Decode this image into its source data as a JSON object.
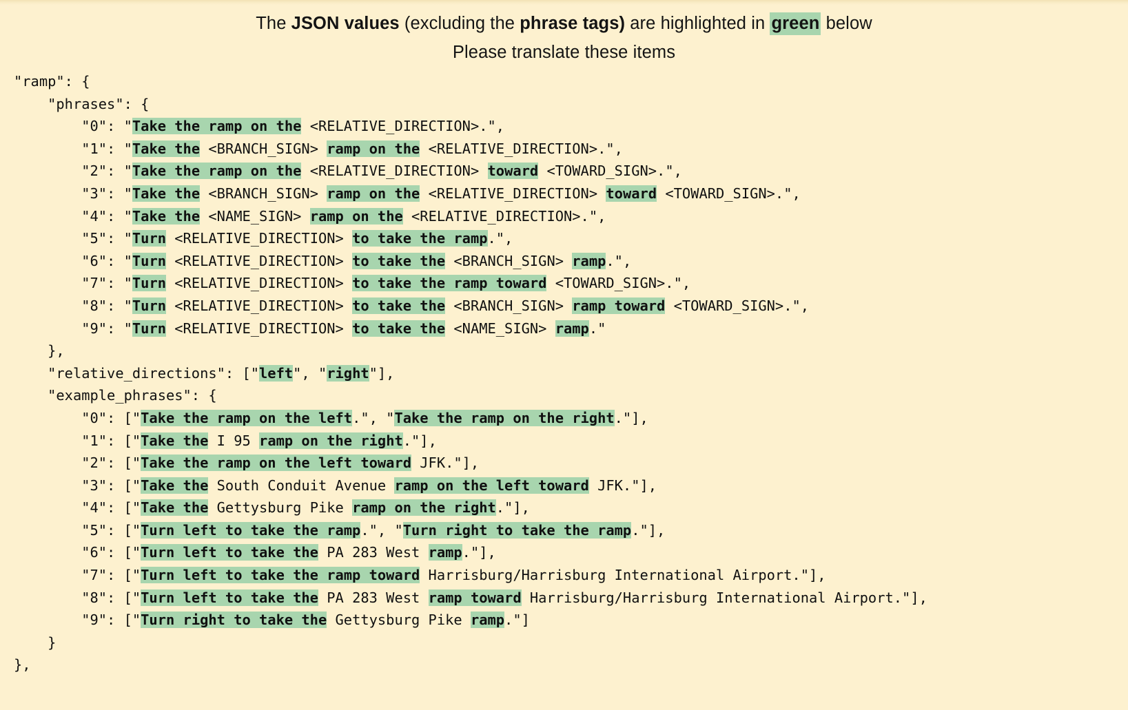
{
  "instructions": {
    "line1_a": "The ",
    "line1_b": "JSON values",
    "line1_c": " (excluding the ",
    "line1_d": "phrase tags)",
    "line1_e": " are highlighted in ",
    "line1_f": "green",
    "line1_g": " below",
    "line2": "Please translate these items"
  },
  "colors": {
    "page_background": "#fdf1cf",
    "highlight_green": "#a8d5ae",
    "text": "#141414"
  },
  "code_lines": [
    {
      "indent": 0,
      "segments": [
        {
          "t": "\"ramp\": {",
          "hl": false
        }
      ]
    },
    {
      "indent": 1,
      "segments": [
        {
          "t": "\"phrases\": {",
          "hl": false
        }
      ]
    },
    {
      "indent": 2,
      "segments": [
        {
          "t": "\"0\": \"",
          "hl": false
        },
        {
          "t": "Take the ramp on the",
          "hl": true
        },
        {
          "t": " <RELATIVE_DIRECTION>.\",",
          "hl": false
        }
      ]
    },
    {
      "indent": 2,
      "segments": [
        {
          "t": "\"1\": \"",
          "hl": false
        },
        {
          "t": "Take the",
          "hl": true
        },
        {
          "t": " <BRANCH_SIGN> ",
          "hl": false
        },
        {
          "t": "ramp on the",
          "hl": true
        },
        {
          "t": " <RELATIVE_DIRECTION>.\",",
          "hl": false
        }
      ]
    },
    {
      "indent": 2,
      "segments": [
        {
          "t": "\"2\": \"",
          "hl": false
        },
        {
          "t": "Take the ramp on the",
          "hl": true
        },
        {
          "t": " <RELATIVE_DIRECTION> ",
          "hl": false
        },
        {
          "t": "toward",
          "hl": true
        },
        {
          "t": " <TOWARD_SIGN>.\",",
          "hl": false
        }
      ]
    },
    {
      "indent": 2,
      "segments": [
        {
          "t": "\"3\": \"",
          "hl": false
        },
        {
          "t": "Take the",
          "hl": true
        },
        {
          "t": " <BRANCH_SIGN> ",
          "hl": false
        },
        {
          "t": "ramp on the",
          "hl": true
        },
        {
          "t": " <RELATIVE_DIRECTION> ",
          "hl": false
        },
        {
          "t": "toward",
          "hl": true
        },
        {
          "t": " <TOWARD_SIGN>.\",",
          "hl": false
        }
      ]
    },
    {
      "indent": 2,
      "segments": [
        {
          "t": "\"4\": \"",
          "hl": false
        },
        {
          "t": "Take the",
          "hl": true
        },
        {
          "t": " <NAME_SIGN> ",
          "hl": false
        },
        {
          "t": "ramp on the",
          "hl": true
        },
        {
          "t": " <RELATIVE_DIRECTION>.\",",
          "hl": false
        }
      ]
    },
    {
      "indent": 2,
      "segments": [
        {
          "t": "\"5\": \"",
          "hl": false
        },
        {
          "t": "Turn",
          "hl": true
        },
        {
          "t": " <RELATIVE_DIRECTION> ",
          "hl": false
        },
        {
          "t": "to take the ramp",
          "hl": true
        },
        {
          "t": ".\",",
          "hl": false
        }
      ]
    },
    {
      "indent": 2,
      "segments": [
        {
          "t": "\"6\": \"",
          "hl": false
        },
        {
          "t": "Turn",
          "hl": true
        },
        {
          "t": " <RELATIVE_DIRECTION> ",
          "hl": false
        },
        {
          "t": "to take the",
          "hl": true
        },
        {
          "t": " <BRANCH_SIGN> ",
          "hl": false
        },
        {
          "t": "ramp",
          "hl": true
        },
        {
          "t": ".\",",
          "hl": false
        }
      ]
    },
    {
      "indent": 2,
      "segments": [
        {
          "t": "\"7\": \"",
          "hl": false
        },
        {
          "t": "Turn",
          "hl": true
        },
        {
          "t": " <RELATIVE_DIRECTION> ",
          "hl": false
        },
        {
          "t": "to take the ramp toward",
          "hl": true
        },
        {
          "t": " <TOWARD_SIGN>.\",",
          "hl": false
        }
      ]
    },
    {
      "indent": 2,
      "segments": [
        {
          "t": "\"8\": \"",
          "hl": false
        },
        {
          "t": "Turn",
          "hl": true
        },
        {
          "t": " <RELATIVE_DIRECTION> ",
          "hl": false
        },
        {
          "t": "to take the",
          "hl": true
        },
        {
          "t": " <BRANCH_SIGN> ",
          "hl": false
        },
        {
          "t": "ramp toward",
          "hl": true
        },
        {
          "t": " <TOWARD_SIGN>.\",",
          "hl": false
        }
      ]
    },
    {
      "indent": 2,
      "segments": [
        {
          "t": "\"9\": \"",
          "hl": false
        },
        {
          "t": "Turn",
          "hl": true
        },
        {
          "t": " <RELATIVE_DIRECTION> ",
          "hl": false
        },
        {
          "t": "to take the",
          "hl": true
        },
        {
          "t": " <NAME_SIGN> ",
          "hl": false
        },
        {
          "t": "ramp",
          "hl": true
        },
        {
          "t": ".\"",
          "hl": false
        }
      ]
    },
    {
      "indent": 1,
      "segments": [
        {
          "t": "},",
          "hl": false
        }
      ]
    },
    {
      "indent": 1,
      "segments": [
        {
          "t": "\"relative_directions\": [\"",
          "hl": false
        },
        {
          "t": "left",
          "hl": true
        },
        {
          "t": "\", \"",
          "hl": false
        },
        {
          "t": "right",
          "hl": true
        },
        {
          "t": "\"],",
          "hl": false
        }
      ]
    },
    {
      "indent": 1,
      "segments": [
        {
          "t": "\"example_phrases\": {",
          "hl": false
        }
      ]
    },
    {
      "indent": 2,
      "segments": [
        {
          "t": "\"0\": [\"",
          "hl": false
        },
        {
          "t": "Take the ramp on the left",
          "hl": true
        },
        {
          "t": ".\", \"",
          "hl": false
        },
        {
          "t": "Take the ramp on the right",
          "hl": true
        },
        {
          "t": ".\"],",
          "hl": false
        }
      ]
    },
    {
      "indent": 2,
      "segments": [
        {
          "t": "\"1\": [\"",
          "hl": false
        },
        {
          "t": "Take the",
          "hl": true
        },
        {
          "t": " I 95 ",
          "hl": false
        },
        {
          "t": "ramp on the right",
          "hl": true
        },
        {
          "t": ".\"],",
          "hl": false
        }
      ]
    },
    {
      "indent": 2,
      "segments": [
        {
          "t": "\"2\": [\"",
          "hl": false
        },
        {
          "t": "Take the ramp on the left toward",
          "hl": true
        },
        {
          "t": " JFK.\"],",
          "hl": false
        }
      ]
    },
    {
      "indent": 2,
      "segments": [
        {
          "t": "\"3\": [\"",
          "hl": false
        },
        {
          "t": "Take the",
          "hl": true
        },
        {
          "t": " South Conduit Avenue ",
          "hl": false
        },
        {
          "t": "ramp on the left toward",
          "hl": true
        },
        {
          "t": " JFK.\"],",
          "hl": false
        }
      ]
    },
    {
      "indent": 2,
      "segments": [
        {
          "t": "\"4\": [\"",
          "hl": false
        },
        {
          "t": "Take the",
          "hl": true
        },
        {
          "t": " Gettysburg Pike ",
          "hl": false
        },
        {
          "t": "ramp on the right",
          "hl": true
        },
        {
          "t": ".\"],",
          "hl": false
        }
      ]
    },
    {
      "indent": 2,
      "segments": [
        {
          "t": "\"5\": [\"",
          "hl": false
        },
        {
          "t": "Turn left to take the ramp",
          "hl": true
        },
        {
          "t": ".\", \"",
          "hl": false
        },
        {
          "t": "Turn right to take the ramp",
          "hl": true
        },
        {
          "t": ".\"],",
          "hl": false
        }
      ]
    },
    {
      "indent": 2,
      "segments": [
        {
          "t": "\"6\": [\"",
          "hl": false
        },
        {
          "t": "Turn left to take the",
          "hl": true
        },
        {
          "t": " PA 283 West ",
          "hl": false
        },
        {
          "t": "ramp",
          "hl": true
        },
        {
          "t": ".\"],",
          "hl": false
        }
      ]
    },
    {
      "indent": 2,
      "segments": [
        {
          "t": "\"7\": [\"",
          "hl": false
        },
        {
          "t": "Turn left to take the ramp toward",
          "hl": true
        },
        {
          "t": " Harrisburg/Harrisburg International Airport.\"],",
          "hl": false
        }
      ]
    },
    {
      "indent": 2,
      "segments": [
        {
          "t": "\"8\": [\"",
          "hl": false
        },
        {
          "t": "Turn left to take the",
          "hl": true
        },
        {
          "t": " PA 283 West ",
          "hl": false
        },
        {
          "t": "ramp toward",
          "hl": true
        },
        {
          "t": " Harrisburg/Harrisburg International Airport.\"],",
          "hl": false
        }
      ]
    },
    {
      "indent": 2,
      "segments": [
        {
          "t": "\"9\": [\"",
          "hl": false
        },
        {
          "t": "Turn right to take the",
          "hl": true
        },
        {
          "t": " Gettysburg Pike ",
          "hl": false
        },
        {
          "t": "ramp",
          "hl": true
        },
        {
          "t": ".\"]",
          "hl": false
        }
      ]
    },
    {
      "indent": 1,
      "segments": [
        {
          "t": "}",
          "hl": false
        }
      ]
    },
    {
      "indent": 0,
      "segments": [
        {
          "t": "},",
          "hl": false
        }
      ]
    }
  ]
}
